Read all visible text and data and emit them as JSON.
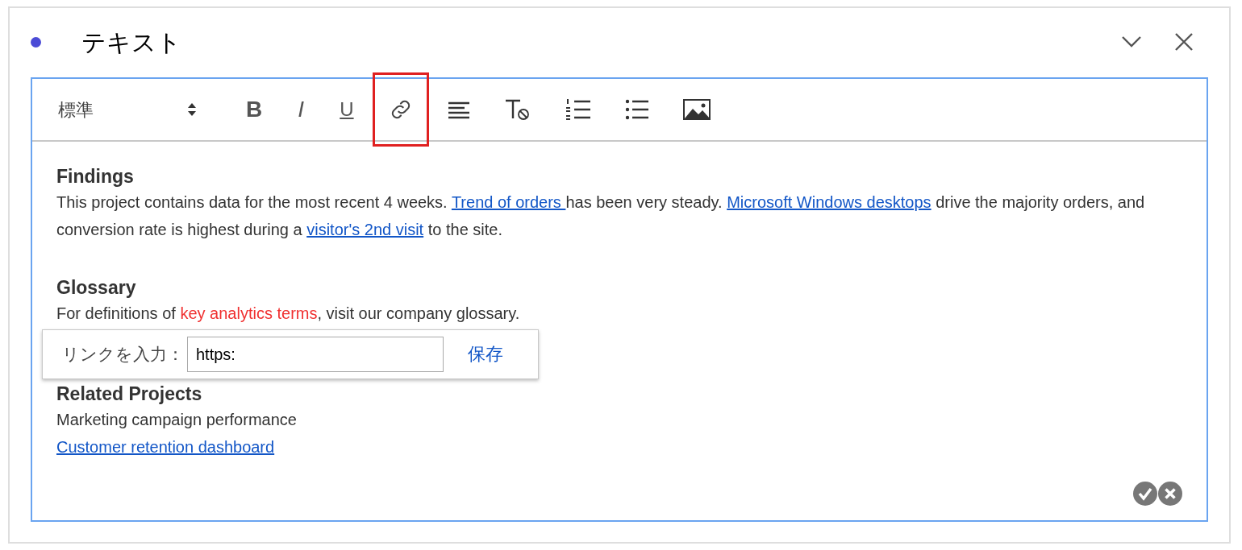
{
  "panel": {
    "title": "テキスト"
  },
  "toolbar": {
    "style_select": "標準",
    "tools": [
      {
        "kind": "bold",
        "label": "B",
        "highlighted": false
      },
      {
        "kind": "italic",
        "label": "I",
        "highlighted": false
      },
      {
        "kind": "underline",
        "label": "U",
        "highlighted": false
      },
      {
        "kind": "link",
        "highlighted": true
      },
      {
        "kind": "align",
        "highlighted": false
      },
      {
        "kind": "clear-format",
        "highlighted": false
      },
      {
        "kind": "ordered-list",
        "highlighted": false
      },
      {
        "kind": "bullet-list",
        "highlighted": false
      },
      {
        "kind": "image",
        "highlighted": false
      }
    ]
  },
  "content": [
    {
      "kind": "heading",
      "text": "Findings"
    },
    {
      "kind": "paragraph",
      "segments": [
        {
          "kind": "text",
          "text": "This project contains data for the most recent 4 weeks. "
        },
        {
          "kind": "link",
          "text": "Trend of orders "
        },
        {
          "kind": "text",
          "text": "has been very steady. "
        },
        {
          "kind": "link",
          "text": "Microsoft Windows desktops"
        },
        {
          "kind": "text",
          "text": " drive the majority orders, and conversion rate is highest during a "
        },
        {
          "kind": "link",
          "text": "visitor's 2nd visit"
        },
        {
          "kind": "text",
          "text": " to the site."
        }
      ]
    },
    {
      "kind": "heading",
      "text": "Glossary"
    },
    {
      "kind": "paragraph",
      "segments": [
        {
          "kind": "text",
          "text": "For definitions of "
        },
        {
          "kind": "error",
          "text": "key analytics terms"
        },
        {
          "kind": "text",
          "text": ", visit our company glossary."
        }
      ]
    },
    {
      "kind": "link_popup",
      "label": "リンクを入力：",
      "value": "https:",
      "save": "保存"
    },
    {
      "kind": "heading",
      "text": "Related Projects"
    },
    {
      "kind": "paragraph",
      "segments": [
        {
          "kind": "text",
          "text": "Marketing campaign performance"
        }
      ]
    },
    {
      "kind": "paragraph",
      "segments": [
        {
          "kind": "link",
          "text": "Customer retention dashboard"
        }
      ]
    }
  ]
}
